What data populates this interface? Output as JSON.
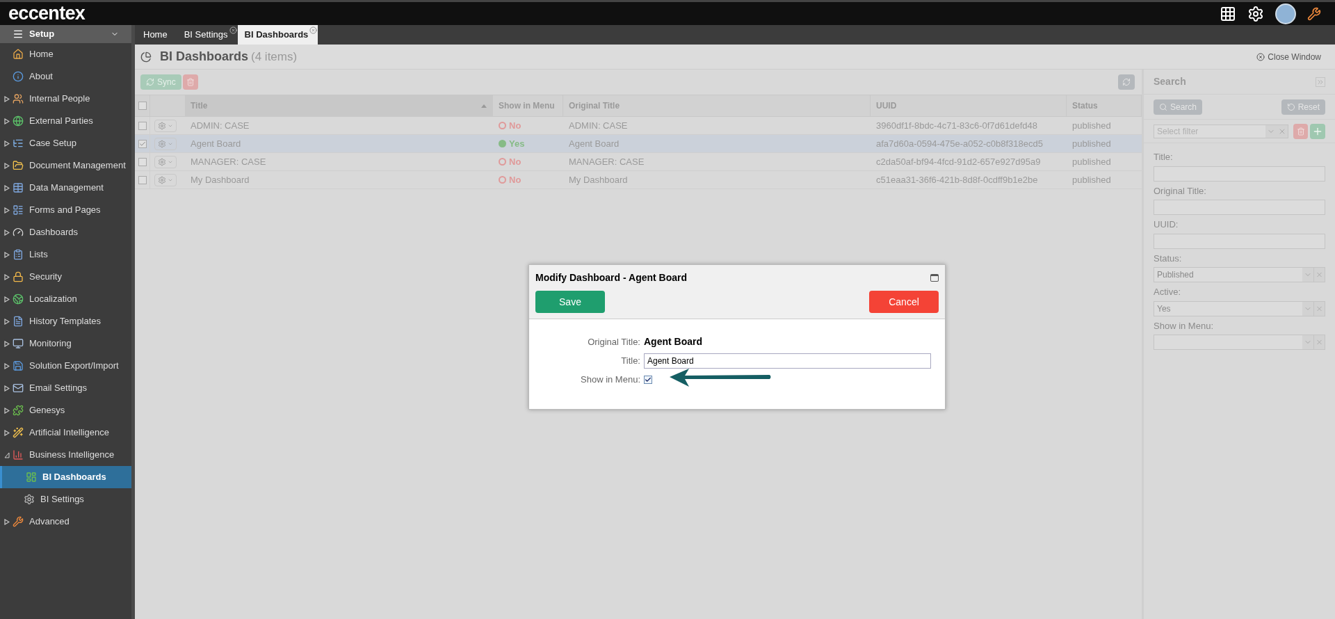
{
  "app": {
    "logo": "eccentex"
  },
  "sidebar": {
    "header": "Setup",
    "items": [
      {
        "label": "Home",
        "kind": "link",
        "selected": false
      },
      {
        "label": "About",
        "kind": "link",
        "selected": false
      },
      {
        "label": "Internal People",
        "kind": "folder",
        "expanded": false,
        "selected": false
      },
      {
        "label": "External Parties",
        "kind": "folder",
        "expanded": false,
        "selected": false
      },
      {
        "label": "Case Setup",
        "kind": "folder",
        "expanded": false,
        "selected": false
      },
      {
        "label": "Document Management",
        "kind": "folder",
        "expanded": false,
        "selected": false
      },
      {
        "label": "Data Management",
        "kind": "folder",
        "expanded": false,
        "selected": false
      },
      {
        "label": "Forms and Pages",
        "kind": "folder",
        "expanded": false,
        "selected": false
      },
      {
        "label": "Dashboards",
        "kind": "folder",
        "expanded": false,
        "selected": false
      },
      {
        "label": "Lists",
        "kind": "folder",
        "expanded": false,
        "selected": false
      },
      {
        "label": "Security",
        "kind": "folder",
        "expanded": false,
        "selected": false
      },
      {
        "label": "Localization",
        "kind": "folder",
        "expanded": false,
        "selected": false
      },
      {
        "label": "History Templates",
        "kind": "folder",
        "expanded": false,
        "selected": false
      },
      {
        "label": "Monitoring",
        "kind": "folder",
        "expanded": false,
        "selected": false
      },
      {
        "label": "Solution Export/Import",
        "kind": "folder",
        "expanded": false,
        "selected": false
      },
      {
        "label": "Email Settings",
        "kind": "folder",
        "expanded": false,
        "selected": false
      },
      {
        "label": "Genesys",
        "kind": "folder",
        "expanded": false,
        "selected": false
      },
      {
        "label": "Artificial Intelligence",
        "kind": "folder",
        "expanded": false,
        "selected": false
      },
      {
        "label": "Business Intelligence",
        "kind": "folder",
        "expanded": true,
        "selected": false,
        "children": [
          {
            "label": "BI Dashboards",
            "selected": true
          },
          {
            "label": "BI Settings",
            "selected": false
          }
        ]
      },
      {
        "label": "Advanced",
        "kind": "folder",
        "expanded": false,
        "selected": false
      }
    ]
  },
  "tabs": [
    {
      "label": "Home",
      "selected": false,
      "closable": false
    },
    {
      "label": "BI Settings",
      "selected": false,
      "closable": true
    },
    {
      "label": "BI Dashboards",
      "selected": true,
      "closable": true
    }
  ],
  "page": {
    "title": "BI Dashboards",
    "count": "(4 items)",
    "close": "Close Window",
    "sync": "Sync"
  },
  "table": {
    "all_checked": false,
    "columns": [
      "Title",
      "Show in Menu",
      "Original Title",
      "UUID",
      "Status"
    ],
    "rows": [
      {
        "checked": false,
        "selected": false,
        "title": "ADMIN: CASE",
        "show_in_menu": {
          "on": false,
          "text": "No"
        },
        "original_title": "ADMIN: CASE",
        "uuid": "3960df1f-8bdc-4c71-83c6-0f7d61defd48",
        "status": "published"
      },
      {
        "checked": true,
        "selected": true,
        "title": "Agent Board",
        "show_in_menu": {
          "on": true,
          "text": "Yes"
        },
        "original_title": "Agent Board",
        "uuid": "afa7d60a-0594-475e-a052-c0b8f318ecd5",
        "status": "published"
      },
      {
        "checked": false,
        "selected": false,
        "title": "MANAGER: CASE",
        "show_in_menu": {
          "on": false,
          "text": "No"
        },
        "original_title": "MANAGER: CASE",
        "uuid": "c2da50af-bf94-4fcd-91d2-657e927d95a9",
        "status": "published"
      },
      {
        "checked": false,
        "selected": false,
        "title": "My Dashboard",
        "show_in_menu": {
          "on": false,
          "text": "No"
        },
        "original_title": "My Dashboard",
        "uuid": "c51eaa31-36f6-421b-8d8f-0cdff9b1e2be",
        "status": "published"
      }
    ]
  },
  "search": {
    "title": "Search",
    "search_button": "Search",
    "reset_button": "Reset",
    "filter_placeholder": "Select filter",
    "fields": [
      {
        "label": "Title:",
        "kind": "text"
      },
      {
        "label": "Original Title:",
        "kind": "text"
      },
      {
        "label": "UUID:",
        "kind": "text"
      },
      {
        "label": "Status:",
        "kind": "select",
        "value": "Published"
      },
      {
        "label": "Active:",
        "kind": "select",
        "value": "Yes"
      },
      {
        "label": "Show in Menu:",
        "kind": "select"
      }
    ]
  },
  "dialog": {
    "title": "Modify Dashboard - Agent Board",
    "save": "Save",
    "cancel": "Cancel",
    "original_title_label": "Original Title:",
    "original_title": "Agent Board",
    "title_label": "Title:",
    "title_value": "Agent Board",
    "show_in_menu_label": "Show in Menu:",
    "show_in_menu": true
  }
}
